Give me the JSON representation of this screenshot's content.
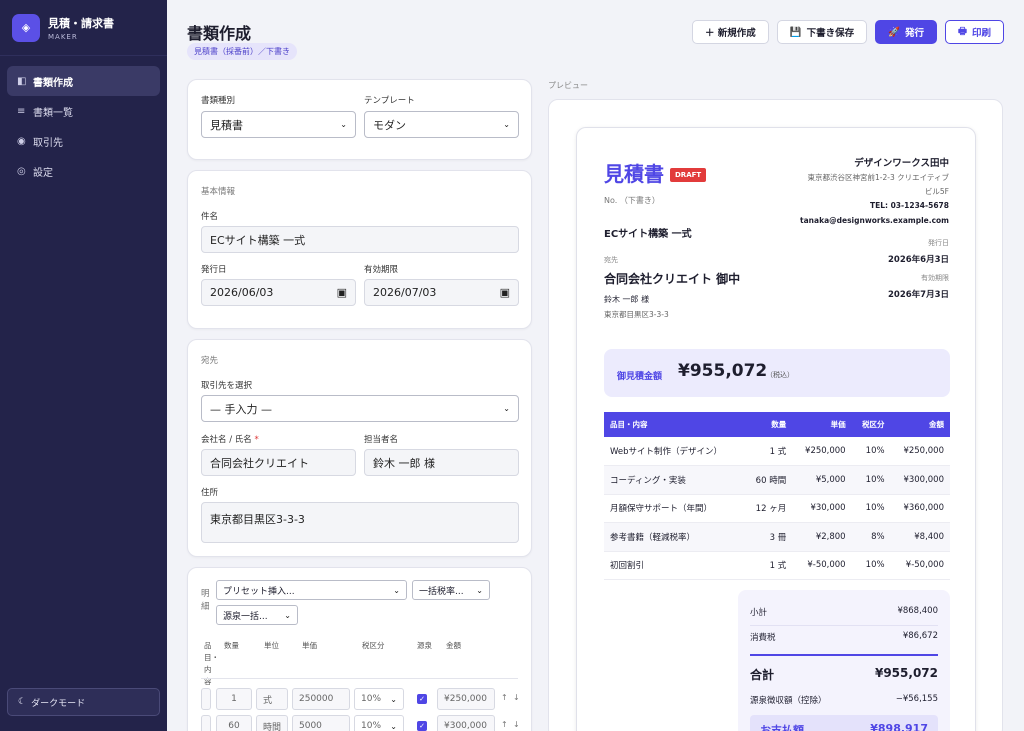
{
  "brand": {
    "title": "見積・請求書",
    "sub": "MAKER"
  },
  "nav": [
    {
      "label": "書類作成",
      "icon": "◧"
    },
    {
      "label": "書類一覧",
      "icon": "≡"
    },
    {
      "label": "取引先",
      "icon": "◉"
    },
    {
      "label": "設定",
      "icon": "◎"
    }
  ],
  "dark_mode": "ダークモード",
  "header": {
    "title": "書類作成",
    "breadcrumb": "見積書（採番前）／下書き"
  },
  "toolbar": {
    "new": "＋ 新規作成",
    "save": "下書き保存",
    "issue": "発行",
    "print": "印刷"
  },
  "doc_type": {
    "label": "書類種別",
    "value": "見積書",
    "template_label": "テンプレート",
    "template_value": "モダン"
  },
  "basic": {
    "section": "基本情報",
    "subject_label": "件名",
    "subject": "ECサイト構築 一式",
    "issue_label": "発行日",
    "issue": "2026/06/03",
    "expiry_label": "有効期限",
    "expiry": "2026/07/03"
  },
  "dest": {
    "section": "宛先",
    "client_label": "取引先を選択",
    "client": "— 手入力 —",
    "company_label": "会社名 / 氏名",
    "company": "合同会社クリエイト",
    "person_label": "担当者名",
    "person": "鈴木 一郎 様",
    "address_label": "住所",
    "address": "東京都目黒区3-3-3"
  },
  "lines": {
    "section": "明細",
    "preset": "プリセット挿入...",
    "bulk_tax": "一括税率...",
    "withhold": "源泉一括...",
    "headers": [
      "品目・内容",
      "数量",
      "単位",
      "単価",
      "税区分",
      "源泉",
      "金額"
    ],
    "rows": [
      {
        "qty": "1",
        "unit": "式",
        "price": "250000",
        "tax": "10%",
        "amount": "¥250,000"
      },
      {
        "qty": "60",
        "unit": "時間",
        "price": "5000",
        "tax": "10%",
        "amount": "¥300,000"
      }
    ]
  },
  "preview": {
    "label": "プレビュー",
    "title": "見積書",
    "badge": "DRAFT",
    "no": "No. （下書き）",
    "subject": "ECサイト構築 一式",
    "issuer": {
      "name": "デザインワークス田中",
      "address": "東京都渋谷区神宮前1-2-3 クリエイティブ",
      "address2": "ビル5F",
      "tel": "TEL: 03-1234-5678",
      "email": "tanaka@designworks.example.com"
    },
    "dates": {
      "issue_label": "発行日",
      "issue": "2026年6月3日",
      "expiry_label": "有効期限",
      "expiry": "2026年7月3日"
    },
    "to": {
      "label": "宛先",
      "company": "合同会社クリエイト 御中",
      "person": "鈴木 一郎 様",
      "address": "東京都目黒区3-3-3"
    },
    "total": {
      "label": "御見積金額",
      "value": "¥955,072",
      "note": "（税込）"
    },
    "table_headers": [
      "品目・内容",
      "数量",
      "単価",
      "税区分",
      "金額"
    ],
    "items": [
      {
        "name": "Webサイト制作（デザイン）",
        "qty": "1 式",
        "price": "¥250,000",
        "tax": "10%",
        "amount": "¥250,000"
      },
      {
        "name": "コーディング・実装",
        "qty": "60 時間",
        "price": "¥5,000",
        "tax": "10%",
        "amount": "¥300,000"
      },
      {
        "name": "月額保守サポート（年間）",
        "qty": "12 ヶ月",
        "price": "¥30,000",
        "tax": "10%",
        "amount": "¥360,000"
      },
      {
        "name": "参考書籍（軽減税率）",
        "qty": "3 冊",
        "price": "¥2,800",
        "tax": "8%",
        "amount": "¥8,400"
      },
      {
        "name": "初回割引",
        "qty": "1 式",
        "price": "¥-50,000",
        "tax": "10%",
        "amount": "¥-50,000"
      }
    ],
    "summary": {
      "subtotal_label": "小計",
      "subtotal": "¥868,400",
      "tax_label": "消費税",
      "tax": "¥86,672",
      "total_label": "合計",
      "total": "¥955,072",
      "withhold_label": "源泉徴収額（控除）",
      "withhold": "−¥56,155",
      "pay_label": "お支払額",
      "pay": "¥898,917"
    }
  }
}
